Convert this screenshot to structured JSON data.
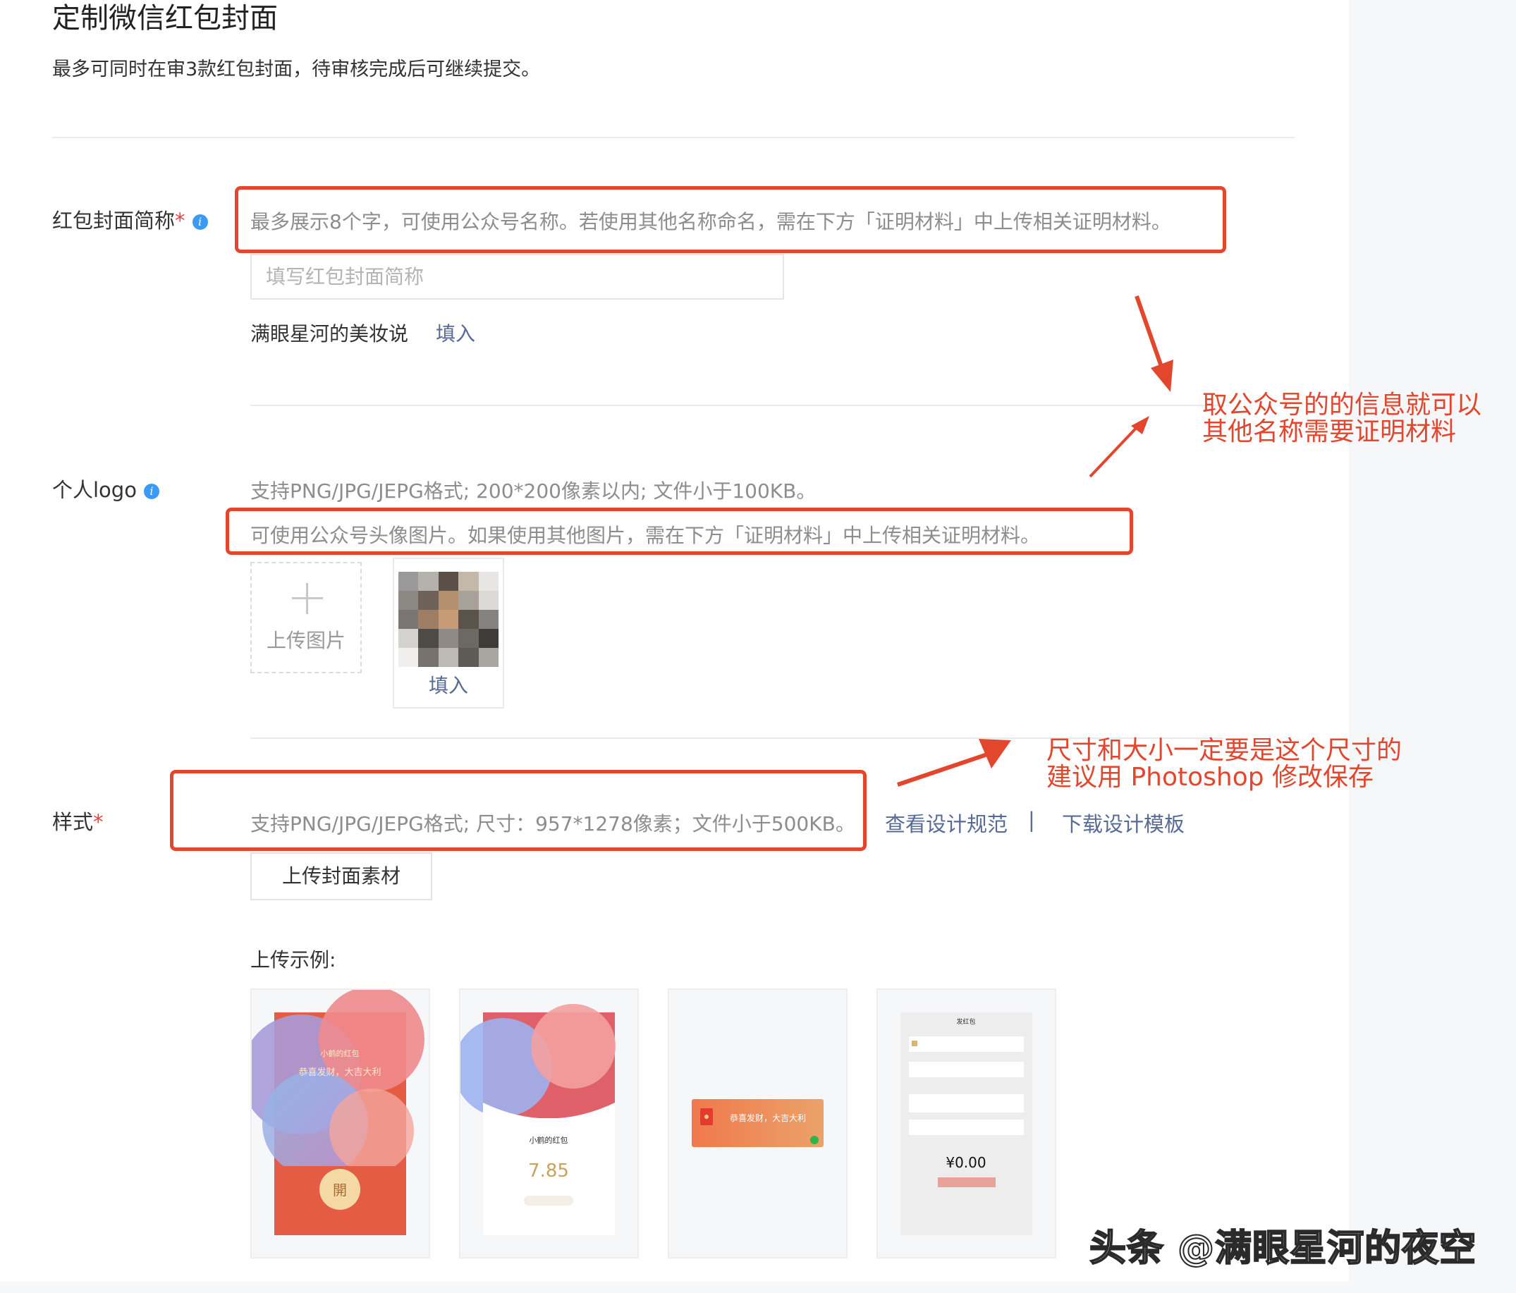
{
  "page": {
    "title": "定制微信红包封面",
    "subtitle": "最多可同时在审3款红包封面，待审核完成后可继续提交。"
  },
  "name_field": {
    "label": "红包封面简称",
    "required_mark": "*",
    "hint": "最多展示8个字，可使用公众号名称。若使用其他名称命名，需在下方「证明材料」中上传相关证明材料。",
    "placeholder": "填写红包封面简称",
    "value": "",
    "suggestion": "满眼星河的美妆说",
    "fill_link": "填入"
  },
  "logo_field": {
    "label": "个人logo",
    "hint_format": "支持PNG/JPG/JEPG格式; 200*200像素以内; 文件小于100KB。",
    "hint_usage": "可使用公众号头像图片。如果使用其他图片，需在下方「证明材料」中上传相关证明材料。",
    "upload_label": "上传图片",
    "avatar_fill": "填入"
  },
  "style_field": {
    "label": "样式",
    "required_mark": "*",
    "hint": "支持PNG/JPG/JEPG格式; 尺寸：957*1278像素；文件小于500KB。",
    "link_spec": "查看设计规范",
    "separator": "|",
    "link_template": "下载设计模板",
    "upload_button": "上传封面素材",
    "example_label": "上传示例:"
  },
  "examples": [
    {
      "title": "小鹤的红包",
      "greeting": "恭喜发财，大吉大利",
      "open": "開"
    },
    {
      "title": "小鹤的红包",
      "amount": "7.85"
    },
    {
      "greeting": "恭喜发财，大吉大利"
    },
    {
      "header": "发红包",
      "amount": "¥0.00"
    }
  ],
  "annotations": {
    "a1_line1": "取公众号的的信息就可以",
    "a1_line2": "其他名称需要证明材料",
    "a2_line1": "尺寸和大小一定要是这个尺寸的",
    "a2_line2": "建议用 Photoshop 修改保存"
  },
  "watermark": "头条 @满眼星河的夜空",
  "colors": {
    "accent_red": "#e2472e",
    "link": "#576b95",
    "info_blue": "#3a9af5",
    "required": "#e64340"
  }
}
